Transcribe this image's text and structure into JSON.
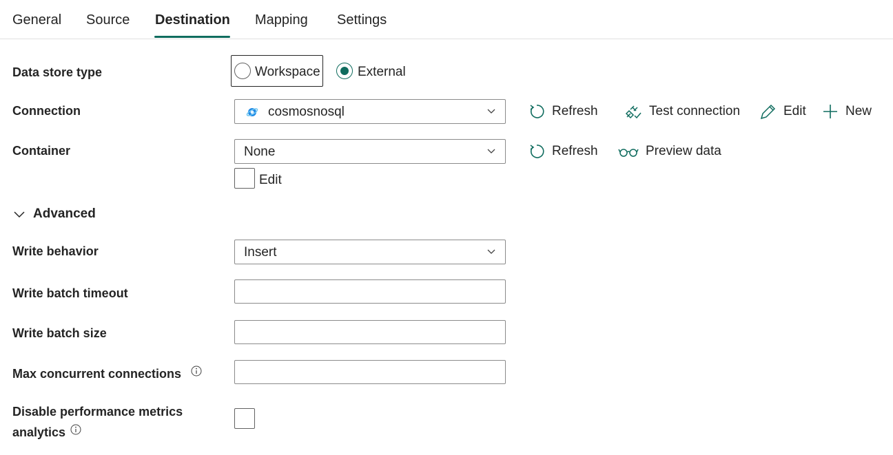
{
  "tabs": [
    {
      "label": "General"
    },
    {
      "label": "Source"
    },
    {
      "label": "Destination",
      "active": true
    },
    {
      "label": "Mapping"
    },
    {
      "label": "Settings"
    }
  ],
  "form": {
    "data_store_type": {
      "label": "Data store type",
      "options": [
        "Workspace",
        "External"
      ],
      "selected": "External"
    },
    "connection": {
      "label": "Connection",
      "value": "cosmosnosql",
      "actions": {
        "refresh": "Refresh",
        "test": "Test connection",
        "edit": "Edit",
        "new": "New"
      }
    },
    "container": {
      "label": "Container",
      "value": "None",
      "actions": {
        "refresh": "Refresh",
        "preview": "Preview data"
      },
      "edit_checkbox_label": "Edit",
      "edit_checked": false
    },
    "advanced": {
      "label": "Advanced",
      "expanded": true
    },
    "write_behavior": {
      "label": "Write behavior",
      "value": "Insert"
    },
    "write_batch_timeout": {
      "label": "Write batch timeout",
      "value": ""
    },
    "write_batch_size": {
      "label": "Write batch size",
      "value": ""
    },
    "max_concurrent_connections": {
      "label": "Max concurrent connections",
      "value": ""
    },
    "disable_perf_metrics": {
      "label_line1": "Disable performance metrics",
      "label_line2": "analytics",
      "checked": false
    }
  },
  "colors": {
    "accent": "#0f6c5e",
    "border": "#8a8a8a",
    "text": "#242424"
  },
  "icons": [
    "refresh-icon",
    "plug-test-icon",
    "pencil-icon",
    "plus-icon",
    "glasses-icon",
    "chevron-down-icon",
    "info-icon",
    "cosmos-db-icon"
  ]
}
